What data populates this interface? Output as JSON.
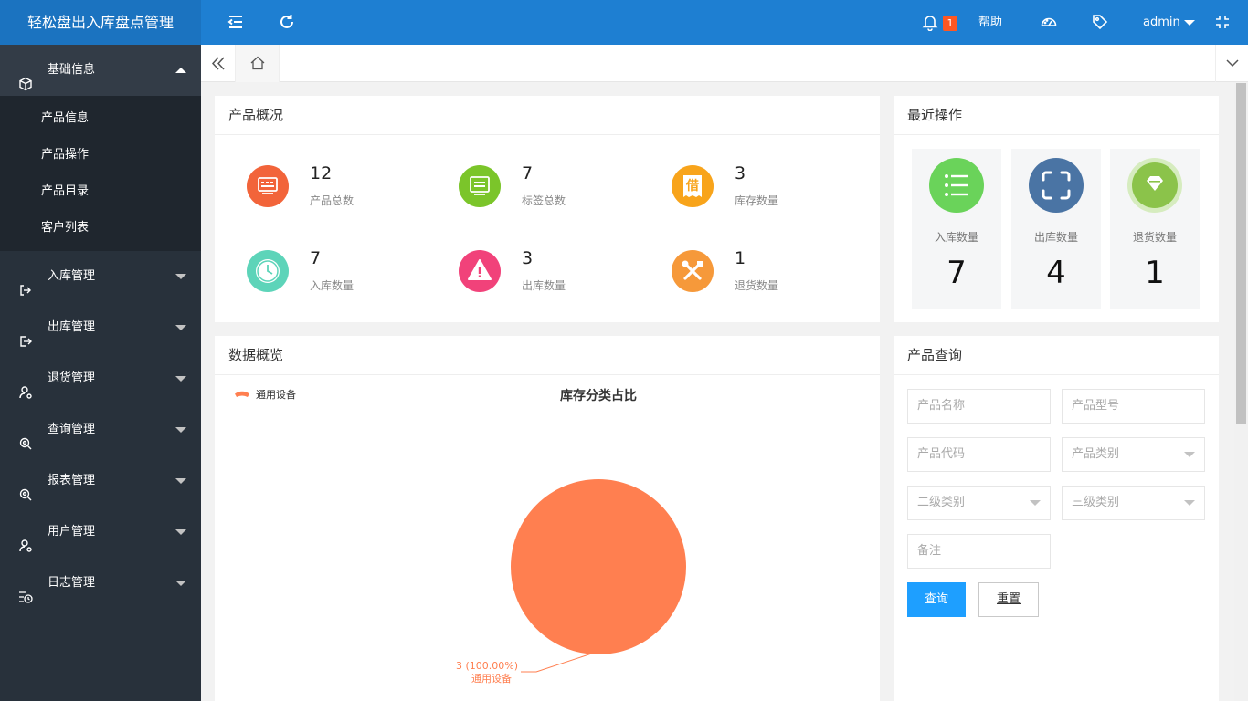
{
  "app": {
    "title": "轻松盘出入库盘点管理"
  },
  "header": {
    "notify_count": "1",
    "help_label": "帮助",
    "user_label": "admin"
  },
  "sidebar": {
    "groups": [
      {
        "label": "基础信息",
        "icon": "cube-icon",
        "open": true,
        "items": [
          "产品信息",
          "产品操作",
          "产品目录",
          "客户列表"
        ]
      },
      {
        "label": "入库管理",
        "icon": "login-icon"
      },
      {
        "label": "出库管理",
        "icon": "logout-icon"
      },
      {
        "label": "退货管理",
        "icon": "user-return-icon"
      },
      {
        "label": "查询管理",
        "icon": "search-icon"
      },
      {
        "label": "报表管理",
        "icon": "report-search-icon"
      },
      {
        "label": "用户管理",
        "icon": "user-icon"
      },
      {
        "label": "日志管理",
        "icon": "log-clock-icon"
      }
    ]
  },
  "overview": {
    "title": "产品概况",
    "stats": [
      {
        "value": "12",
        "label": "产品总数",
        "color": "#f2643a"
      },
      {
        "value": "7",
        "label": "标签总数",
        "color": "#7bc52a"
      },
      {
        "value": "3",
        "label": "库存数量",
        "color": "#f8a41b",
        "glyph": "借"
      },
      {
        "value": "7",
        "label": "入库数量",
        "color": "#5dd4b9"
      },
      {
        "value": "3",
        "label": "出库数量",
        "color": "#f1427a"
      },
      {
        "value": "1",
        "label": "退货数量",
        "color": "#f6993a"
      }
    ]
  },
  "recent": {
    "title": "最近操作",
    "cards": [
      {
        "label": "入库数量",
        "value": "7",
        "color": "#6ad35a"
      },
      {
        "label": "出库数量",
        "value": "4",
        "color": "#4a74a4"
      },
      {
        "label": "退货数量",
        "value": "1",
        "color": "#8bc34a"
      }
    ]
  },
  "data_panel": {
    "title": "数据概览"
  },
  "chart_data": {
    "type": "pie",
    "title": "库存分类占比",
    "legend": [
      "通用设备"
    ],
    "legend_position": "top-left",
    "slices": [
      {
        "name": "通用设备",
        "value": 3,
        "percent": 100.0,
        "color": "#ff7f50"
      }
    ],
    "slice_label_value": "3 (100.00%)",
    "slice_label_name": "通用设备"
  },
  "query": {
    "title": "产品查询",
    "fields": [
      {
        "placeholder": "产品名称",
        "type": "input"
      },
      {
        "placeholder": "产品型号",
        "type": "input"
      },
      {
        "placeholder": "产品代码",
        "type": "input"
      },
      {
        "placeholder": "产品类别",
        "type": "select"
      },
      {
        "placeholder": "二级类别",
        "type": "select"
      },
      {
        "placeholder": "三级类别",
        "type": "select"
      },
      {
        "placeholder": "备注",
        "type": "input"
      }
    ],
    "search_label": "查询",
    "reset_label": "重置"
  }
}
